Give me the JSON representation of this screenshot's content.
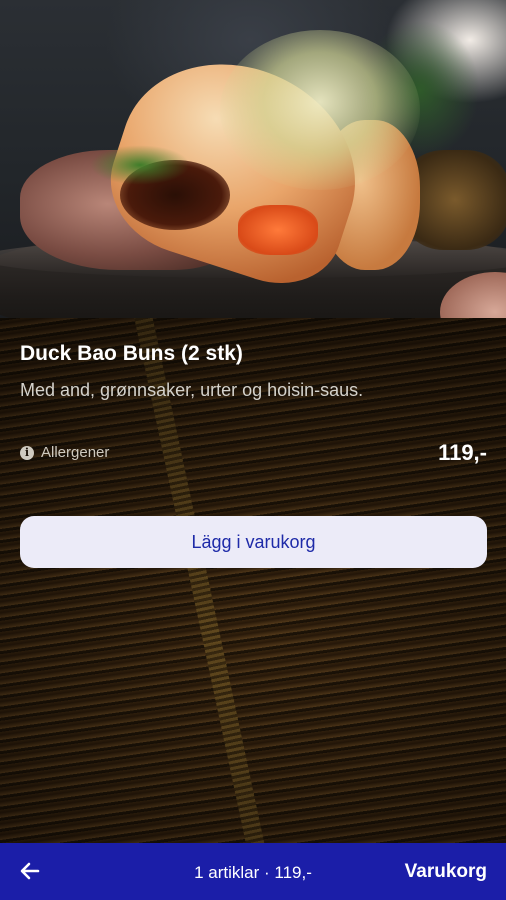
{
  "product": {
    "title": "Duck Bao Buns (2 stk)",
    "description": "Med and, grønnsaker, urter og hoisin-saus.",
    "allergen_label": "Allergener",
    "price": "119,-",
    "add_button_label": "Lägg i varukorg",
    "image_subject": "duck bao bun with sprouts, hoisin and carrot on a dark plate"
  },
  "cart": {
    "summary": "1 artiklar · 119,-",
    "link_label": "Varukorg"
  },
  "icons": {
    "back": "arrow-left-icon",
    "info": "info-icon"
  },
  "colors": {
    "cart_bar": "#1b1ea8",
    "button_bg": "#ecebf8",
    "button_text": "#1e2aa8"
  }
}
